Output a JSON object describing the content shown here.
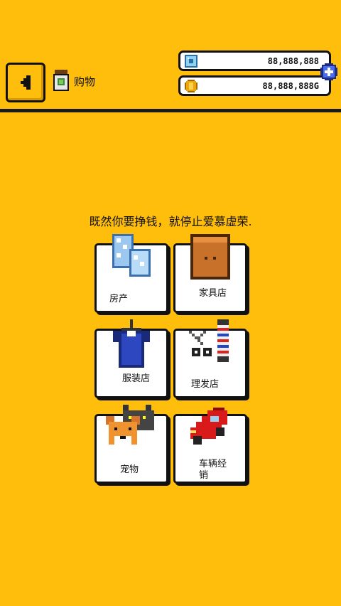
{
  "header": {
    "page_title": "购物",
    "gems": "88,888,888",
    "coins": "88,888,888G"
  },
  "slogan": "既然你要挣钱，就停止爱慕虚荣.",
  "categories": [
    {
      "label": "房产",
      "icon": "buildings-icon"
    },
    {
      "label": "家具店",
      "icon": "wardrobe-icon"
    },
    {
      "label": "服装店",
      "icon": "shirt-on-hanger-icon"
    },
    {
      "label": "理发店",
      "icon": "barber-pole-scissors-icon"
    },
    {
      "label": "宠物",
      "icon": "cat-dog-icon"
    },
    {
      "label": "车辆经销",
      "icon": "red-car-icon"
    }
  ]
}
